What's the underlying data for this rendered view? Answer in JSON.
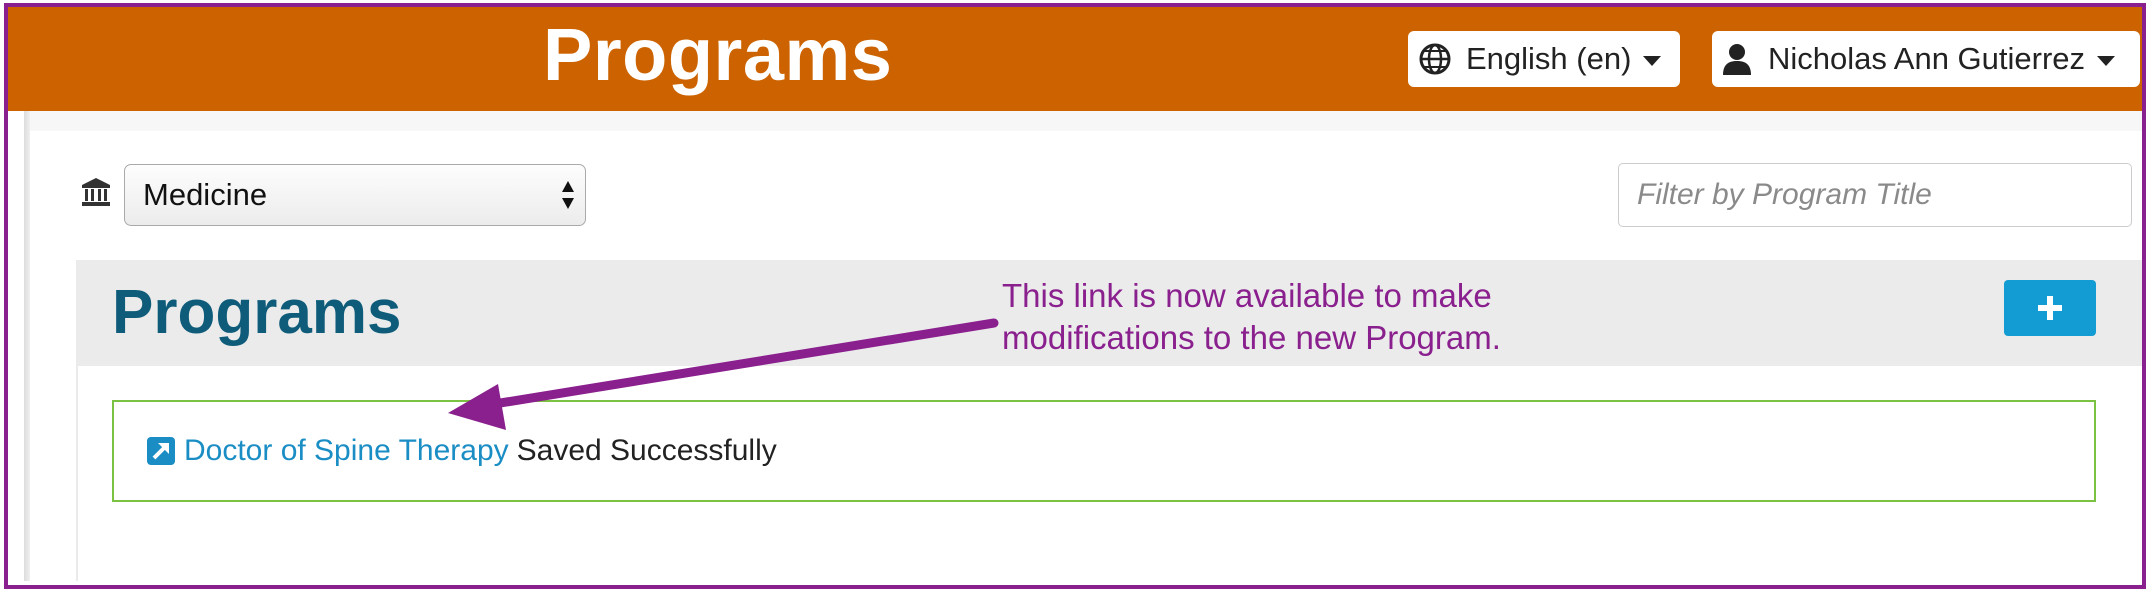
{
  "header": {
    "title": "Programs",
    "language_label": "English (en)",
    "user_name": "Nicholas Ann Gutierrez"
  },
  "filters": {
    "institution_icon": "institution-icon",
    "institution_selected": "Medicine",
    "program_filter_placeholder": "Filter by Program Title"
  },
  "panel": {
    "title": "Programs",
    "add_button_icon": "plus-icon"
  },
  "alert": {
    "link_text": "Doctor of Spine Therapy",
    "message": "Saved Successfully",
    "link_icon": "external-link-icon"
  },
  "annotation": {
    "line1": "This link is now available to make",
    "line2": "modifications to the new Program."
  },
  "colors": {
    "header_bg": "#cc6300",
    "annotation": "#8a1f8e",
    "title_blue": "#0f5c7a",
    "button_blue": "#139cd3",
    "link_blue": "#1a8dc4",
    "alert_border": "#7bc142"
  }
}
